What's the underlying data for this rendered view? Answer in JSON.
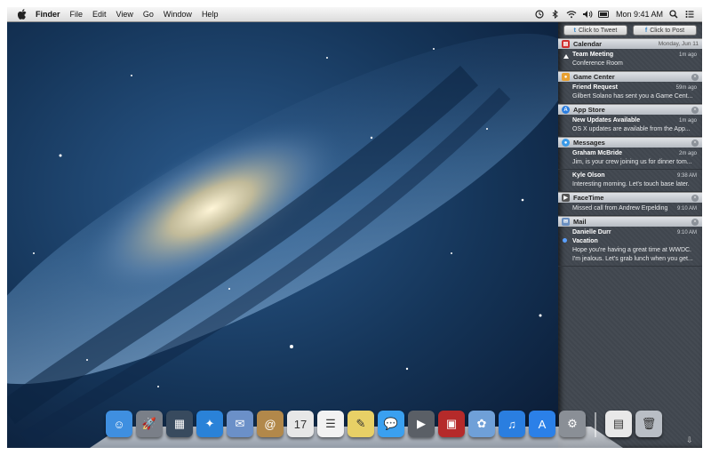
{
  "menubar": {
    "app_name": "Finder",
    "items": [
      "File",
      "Edit",
      "View",
      "Go",
      "Window",
      "Help"
    ],
    "clock": "Mon 9:41 AM",
    "status_icons": [
      "time-machine-icon",
      "bluetooth-icon",
      "wifi-icon",
      "volume-icon",
      "battery-icon",
      "spotlight-icon",
      "notification-list-icon"
    ]
  },
  "notification_center": {
    "share": {
      "tweet": "Click to Tweet",
      "post": "Click to Post"
    },
    "sections": [
      {
        "app": "Calendar",
        "right": "Monday, Jun 11",
        "icon": "calendar-icon",
        "color": "#d03030",
        "items": [
          {
            "title": "Team Meeting",
            "time": "1m ago",
            "body": "Conference Room"
          }
        ]
      },
      {
        "app": "Game Center",
        "right": "×",
        "icon": "game-center-icon",
        "color": "#e8a030",
        "items": [
          {
            "title": "Friend Request",
            "time": "59m ago",
            "body": "Gilbert Solano has sent you a Game Cent..."
          }
        ]
      },
      {
        "app": "App Store",
        "right": "×",
        "icon": "app-store-icon",
        "color": "#2a7de0",
        "items": [
          {
            "title": "New Updates Available",
            "time": "1m ago",
            "body": "OS X updates are available from the App..."
          }
        ]
      },
      {
        "app": "Messages",
        "right": "×",
        "icon": "messages-icon",
        "color": "#3a9ae8",
        "items": [
          {
            "title": "Graham McBride",
            "time": "2m ago",
            "body": "Jim, is your crew joining us for dinner tom..."
          },
          {
            "title": "Kyle Olson",
            "time": "9:38 AM",
            "body": "Interesting morning. Let's touch base later."
          }
        ]
      },
      {
        "app": "FaceTime",
        "right": "×",
        "icon": "facetime-icon",
        "color": "#555555",
        "items": [
          {
            "title": "",
            "time": "9:10 AM",
            "body": "Missed call from Andrew Erpelding"
          }
        ]
      },
      {
        "app": "Mail",
        "right": "×",
        "icon": "mail-icon",
        "color": "#6a8fc0",
        "items": [
          {
            "title": "Danielle Durr",
            "subtitle": "Vacation",
            "time": "9:10 AM",
            "body": "Hope you're having a great time at WWDC.",
            "body2": "I'm jealous. Let's grab lunch when you get..."
          }
        ]
      }
    ]
  },
  "dock": {
    "apps": [
      {
        "name": "finder-icon",
        "glyph": "☺",
        "color": "#3f8fe0"
      },
      {
        "name": "launchpad-icon",
        "glyph": "🚀",
        "color": "#7a7f88"
      },
      {
        "name": "mission-control-icon",
        "glyph": "▦",
        "color": "#384a5e"
      },
      {
        "name": "safari-icon",
        "glyph": "✦",
        "color": "#2a82d8"
      },
      {
        "name": "mail-dock-icon",
        "glyph": "✉",
        "color": "#6b90c8"
      },
      {
        "name": "contacts-icon",
        "glyph": "@",
        "color": "#b2884a"
      },
      {
        "name": "calendar-dock-icon",
        "glyph": "17",
        "color": "#e7e7e7"
      },
      {
        "name": "reminders-icon",
        "glyph": "☰",
        "color": "#f2f2f2"
      },
      {
        "name": "notes-icon",
        "glyph": "✎",
        "color": "#e8d066"
      },
      {
        "name": "messages-dock-icon",
        "glyph": "💬",
        "color": "#3aa0f0"
      },
      {
        "name": "facetime-dock-icon",
        "glyph": "▶",
        "color": "#5a5f66"
      },
      {
        "name": "photo-booth-icon",
        "glyph": "▣",
        "color": "#b52a2a"
      },
      {
        "name": "iphoto-icon",
        "glyph": "✿",
        "color": "#6fa0d8"
      },
      {
        "name": "itunes-icon",
        "glyph": "♫",
        "color": "#2a7ee0"
      },
      {
        "name": "app-store-dock-icon",
        "glyph": "A",
        "color": "#2b80e8"
      },
      {
        "name": "system-preferences-icon",
        "glyph": "⚙",
        "color": "#8a8f96"
      }
    ],
    "right": [
      {
        "name": "documents-stack-icon",
        "glyph": "▤",
        "color": "#e8e8e8"
      },
      {
        "name": "trash-icon",
        "glyph": "🗑",
        "color": "#b9bec5"
      }
    ]
  }
}
